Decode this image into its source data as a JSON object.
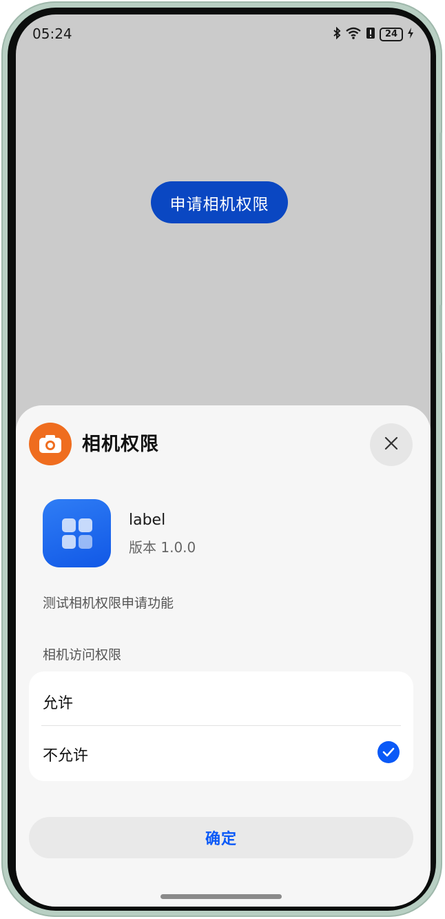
{
  "status_bar": {
    "time": "05:24",
    "battery": "24",
    "icons": [
      "bluetooth-icon",
      "wifi-icon",
      "alert-icon",
      "battery-icon",
      "charging-icon"
    ]
  },
  "background": {
    "request_button_label": "申请相机权限"
  },
  "sheet": {
    "title": "相机权限",
    "header_icon": "camera-icon",
    "close_icon": "close-icon",
    "app": {
      "name": "label",
      "version": "版本 1.0.0",
      "icon": "app-grid-icon"
    },
    "description": "测试相机权限申请功能",
    "section_label": "相机访问权限",
    "options": [
      {
        "label": "允许",
        "selected": false
      },
      {
        "label": "不允许",
        "selected": true
      }
    ],
    "confirm_label": "确定"
  },
  "colors": {
    "accent": "#0a59f7",
    "request_button": "#0a47c2",
    "header_icon_bg": "#ef6d1f",
    "app_icon_bg": "#1a66ef"
  }
}
